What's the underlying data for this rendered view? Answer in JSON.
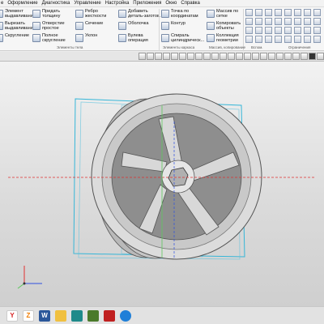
{
  "menu": [
    "е",
    "Оформление",
    "Диагностика",
    "Управление",
    "Настройка",
    "Приложения",
    "Окно",
    "Справка"
  ],
  "ribbon": {
    "col1": [
      "Элемент выдавливания",
      "Вырезать выдавливанием",
      "Скругление"
    ],
    "col2": [
      "Придать толщину",
      "Отверстие простое",
      "Полное скругление"
    ],
    "col3": [
      "Ребро жесткости",
      "Сечение",
      "Уклон"
    ],
    "col4": [
      "Добавить деталь-заготов...",
      "Оболочка",
      "Булева операция"
    ],
    "col5": [
      "Точка по координатам",
      "Контур",
      "Спираль цилиндрическ..."
    ],
    "col6": [
      "Массив по сетке",
      "Копировать объекты",
      "Коллекция геометрии"
    ],
    "group_labels": {
      "body": "Элементы тела",
      "frame": "Элементы каркаса",
      "arrays": "Массив, копирование",
      "aux": "Вспом.",
      "constraints": "Ограничения"
    }
  },
  "taskbar": {
    "icons": [
      "y-icon",
      "z-icon",
      "word-icon",
      "folder-icon",
      "store-icon",
      "game-icon",
      "kompas-icon",
      "edge-icon"
    ],
    "letters": [
      "Y",
      "Z",
      "W",
      "",
      "",
      "",
      "",
      ""
    ]
  },
  "colors": {
    "viewport_bg": "#e6e6e6",
    "frame_cyan": "#35b6d8",
    "axis_red": "#e03030",
    "axis_green": "#5cc85c",
    "axis_blue": "#3050e0"
  }
}
